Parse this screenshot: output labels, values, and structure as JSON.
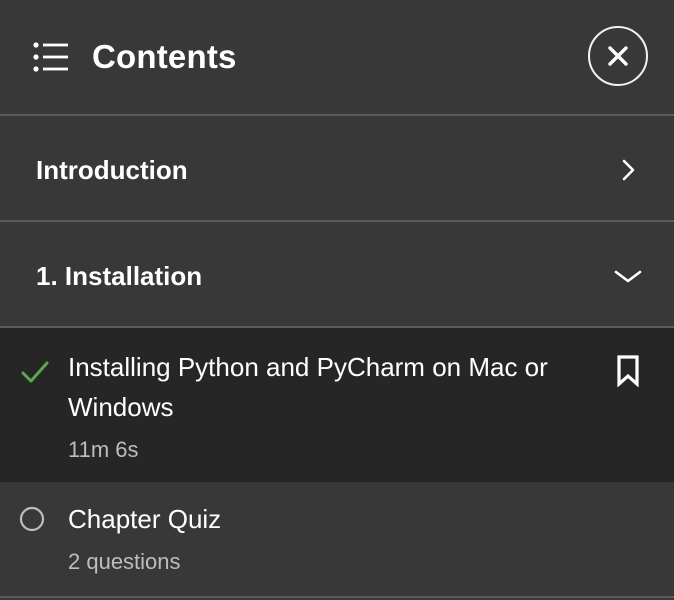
{
  "header": {
    "title": "Contents",
    "menu_icon": "list-icon",
    "close_icon": "close-icon"
  },
  "sections": [
    {
      "title": "Introduction",
      "state": "collapsed",
      "icon": "chevron-right-icon"
    },
    {
      "title": "1. Installation",
      "state": "expanded",
      "icon": "chevron-down-icon"
    }
  ],
  "lessons": [
    {
      "title": "Installing Python and PyCharm on Mac or Windows",
      "meta": "11m 6s",
      "status": "completed",
      "status_icon": "checkmark-icon",
      "bookmark_icon": "bookmark-icon",
      "active": true
    },
    {
      "title": "Chapter Quiz",
      "meta": "2 questions",
      "status": "not-started",
      "status_icon": "empty-circle-icon",
      "active": false
    }
  ],
  "colors": {
    "panel_background": "#383838",
    "active_row_background": "#262626",
    "divider": "#5a5a5a",
    "completed_check": "#5ba84f",
    "meta_text": "#bdbdbd"
  }
}
